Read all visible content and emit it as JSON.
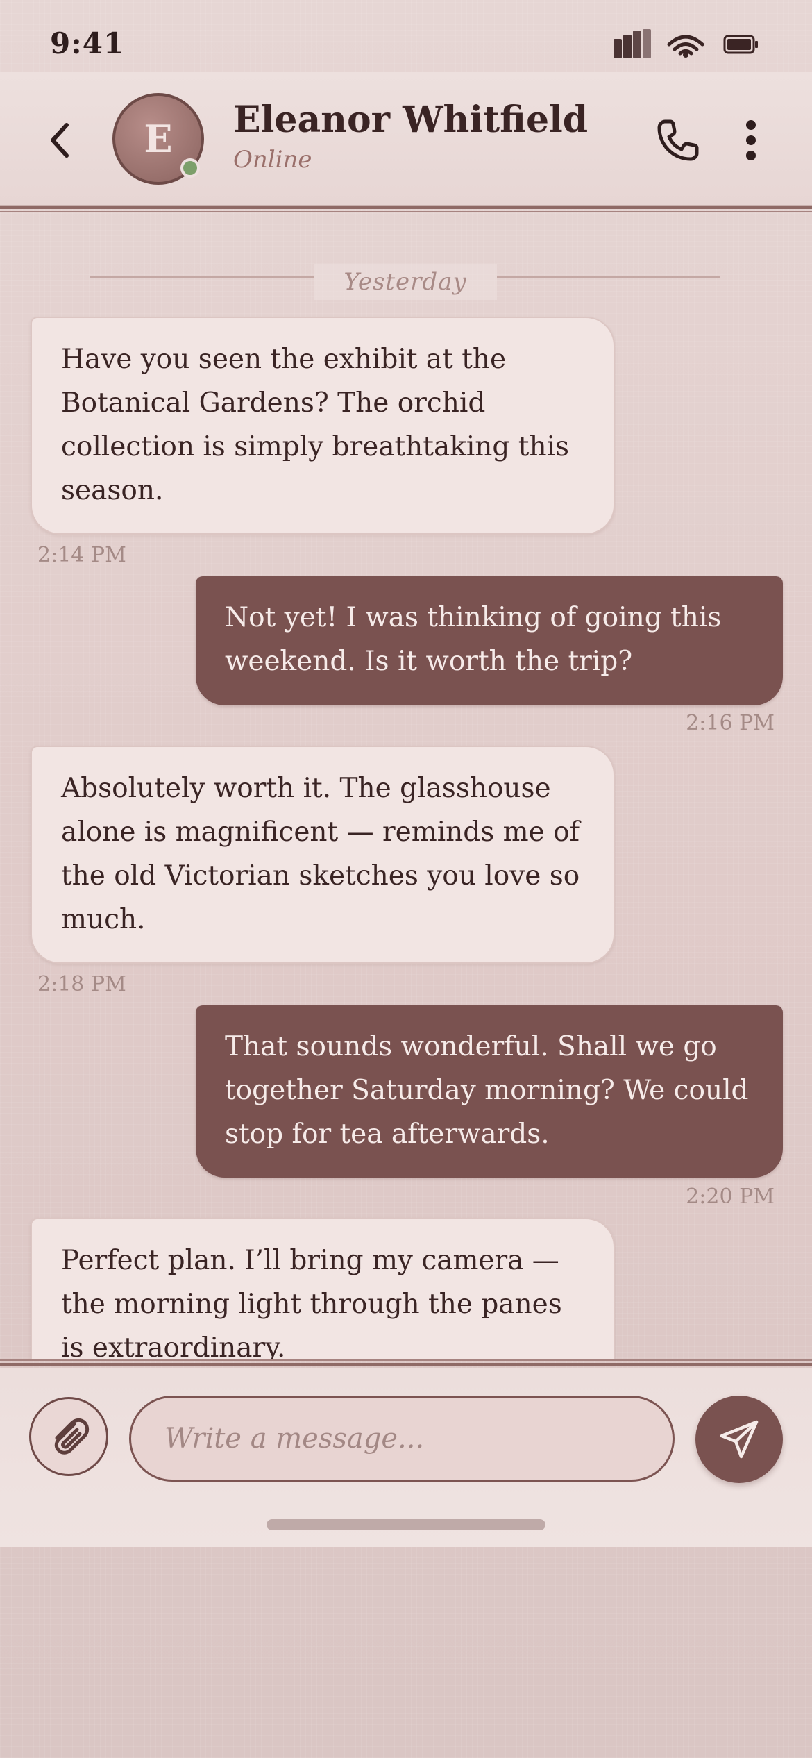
{
  "status_bar": {
    "time": "9:41"
  },
  "header": {
    "avatar_initial": "E",
    "contact_name": "Eleanor Whitfield",
    "contact_status": "Online"
  },
  "date_divider": "Yesterday",
  "messages": [
    {
      "direction": "incoming",
      "text": "Have you seen the exhibit at the Botanical Gardens? The orchid collection is simply breathtaking this season.",
      "time": "2:14 PM"
    },
    {
      "direction": "outgoing",
      "text": "Not yet! I was thinking of going this weekend. Is it worth the trip?",
      "time": "2:16 PM"
    },
    {
      "direction": "incoming",
      "text": "Absolutely worth it. The glasshouse alone is magnificent — reminds me of the old Victorian sketches you love so much.",
      "time": "2:18 PM"
    },
    {
      "direction": "outgoing",
      "text": "That sounds wonderful. Shall we go together Saturday morning? We could stop for tea afterwards.",
      "time": "2:20 PM"
    },
    {
      "direction": "incoming",
      "text": "Perfect plan. I’ll bring my camera — the morning light through the panes is extraordinary.",
      "time": ""
    }
  ],
  "composer": {
    "placeholder": "Write a message..."
  },
  "colors": {
    "accent": "#7a5250",
    "incoming_bubble": "#f2e5e3",
    "online_indicator": "#7c9f6a"
  },
  "icons": {
    "status": [
      "signal-icon",
      "wifi-icon",
      "battery-icon"
    ],
    "header": [
      "back-arrow-icon",
      "phone-icon",
      "more-vertical-icon"
    ],
    "composer": [
      "paperclip-icon",
      "send-icon"
    ]
  }
}
